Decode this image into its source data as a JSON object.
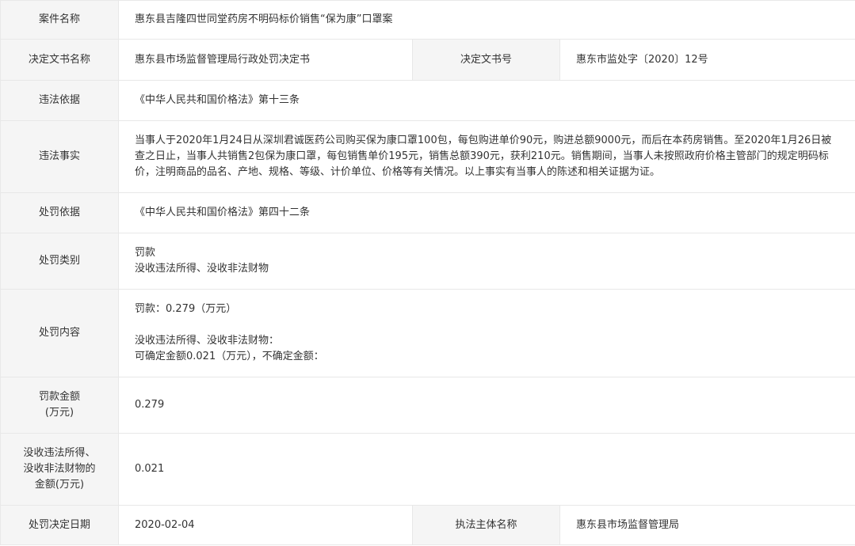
{
  "rows": {
    "case_name": {
      "label": "案件名称",
      "value": "惠东县吉隆四世同堂药房不明码标价销售“保为康”口罩案"
    },
    "doc_name": {
      "label": "决定文书名称",
      "value": "惠东县市场监督管理局行政处罚决定书",
      "label2": "决定文书号",
      "value2": "惠东市监处字〔2020〕12号"
    },
    "violation_basis": {
      "label": "违法依据",
      "value": "《中华人民共和国价格法》第十三条"
    },
    "facts": {
      "label": "违法事实",
      "value": "当事人于2020年1月24日从深圳君诚医药公司购买保为康口罩100包，每包购进单价90元，购进总额9000元，而后在本药房销售。至2020年1月26日被查之日止，当事人共销售2包保为康口罩，每包销售单价195元，销售总额390元，获利210元。销售期间，当事人未按照政府价格主管部门的规定明码标价，注明商品的品名、产地、规格、等级、计价单位、价格等有关情况。以上事实有当事人的陈述和相关证据为证。"
    },
    "penalty_basis": {
      "label": "处罚依据",
      "value": "《中华人民共和国价格法》第四十二条"
    },
    "penalty_type": {
      "label": "处罚类别",
      "value_line1": "罚款",
      "value_line2": "没收违法所得、没收非法财物"
    },
    "penalty_content": {
      "label": "处罚内容",
      "line1": "罚款：0.279（万元）",
      "line2": "没收违法所得、没收非法财物：",
      "line3": "可确定金额0.021（万元），不确定金额："
    },
    "fine_amount": {
      "label_line1": "罚款金额",
      "label_line2": "(万元)",
      "value": "0.279"
    },
    "confiscation_amount": {
      "label_line1": "没收违法所得、",
      "label_line2": "没收非法财物的",
      "label_line3": "金额(万元)",
      "value": "0.021"
    },
    "decision_date": {
      "label": "处罚决定日期",
      "value": "2020-02-04",
      "label2": "执法主体名称",
      "value2": "惠东县市场监督管理局"
    }
  }
}
